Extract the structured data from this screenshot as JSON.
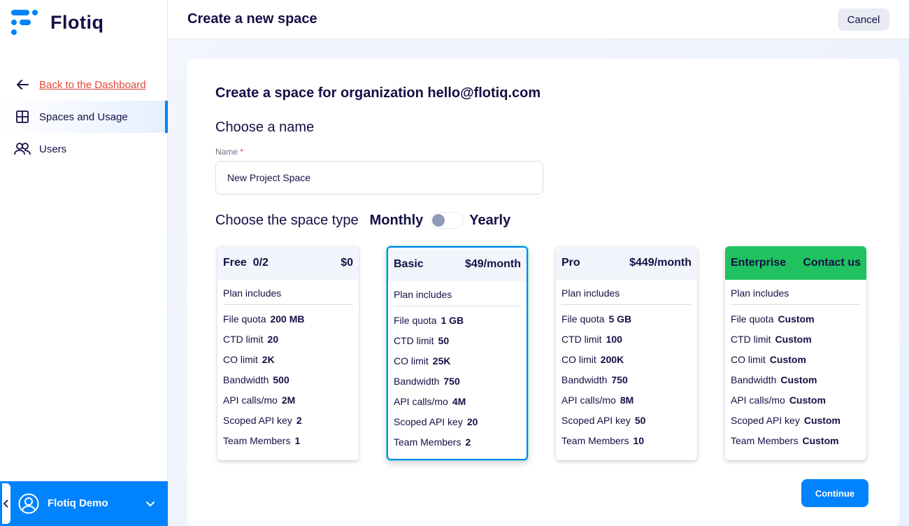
{
  "brand": {
    "name": "Flotiq",
    "color": "#0083fc"
  },
  "sidebar": {
    "items": [
      {
        "label": "Back to the Dashboard",
        "icon": "arrow-left-icon"
      },
      {
        "label": "Spaces and Usage",
        "icon": "grid-icon",
        "active": true
      },
      {
        "label": "Users",
        "icon": "users-icon"
      }
    ],
    "user": {
      "name": "Flotiq Demo",
      "icon": "user-circle-icon"
    }
  },
  "header": {
    "title": "Create a new space",
    "cancel_label": "Cancel"
  },
  "main": {
    "org_title": "Create a space for organization hello@flotiq.com",
    "choose_name": "Choose a name",
    "name_label": "Name",
    "name_required": "*",
    "name_value": "New Project Space",
    "choose_type": "Choose the space type",
    "monthly": "Monthly",
    "yearly": "Yearly",
    "billing_yearly": false,
    "continue_label": "Continue"
  },
  "plans": [
    {
      "name": "Free  0/2",
      "price": "$0",
      "includes": "Plan includes",
      "features": [
        {
          "label": "File quota",
          "value": "200 MB"
        },
        {
          "label": "CTD limit",
          "value": "20"
        },
        {
          "label": "CO limit",
          "value": "2K"
        },
        {
          "label": "Bandwidth",
          "value": "500"
        },
        {
          "label": "API calls/mo",
          "value": "2M"
        },
        {
          "label": "Scoped API key",
          "value": "2"
        },
        {
          "label": "Team Members",
          "value": "1"
        }
      ]
    },
    {
      "name": "Basic",
      "price": "$49/month",
      "includes": "Plan includes",
      "selected": true,
      "features": [
        {
          "label": "File quota",
          "value": "1 GB"
        },
        {
          "label": "CTD limit",
          "value": "50"
        },
        {
          "label": "CO limit",
          "value": "25K"
        },
        {
          "label": "Bandwidth",
          "value": "750"
        },
        {
          "label": "API calls/mo",
          "value": "4M"
        },
        {
          "label": "Scoped API key",
          "value": "20"
        },
        {
          "label": "Team Members",
          "value": "2"
        }
      ]
    },
    {
      "name": "Pro",
      "price": "$449/month",
      "includes": "Plan includes",
      "features": [
        {
          "label": "File quota",
          "value": "5 GB"
        },
        {
          "label": "CTD limit",
          "value": "100"
        },
        {
          "label": "CO limit",
          "value": "200K"
        },
        {
          "label": "Bandwidth",
          "value": "750"
        },
        {
          "label": "API calls/mo",
          "value": "8M"
        },
        {
          "label": "Scoped API key",
          "value": "50"
        },
        {
          "label": "Team Members",
          "value": "10"
        }
      ]
    },
    {
      "name": "Enterprise",
      "price": "Contact us",
      "includes": "Plan includes",
      "accent": "#1fc25e",
      "features": [
        {
          "label": "File quota",
          "value": "Custom"
        },
        {
          "label": "CTD limit",
          "value": "Custom"
        },
        {
          "label": "CO limit",
          "value": "Custom"
        },
        {
          "label": "Bandwidth",
          "value": "Custom"
        },
        {
          "label": "API calls/mo",
          "value": "Custom"
        },
        {
          "label": "Scoped API key",
          "value": "Custom"
        },
        {
          "label": "Team Members",
          "value": "Custom"
        }
      ]
    }
  ]
}
